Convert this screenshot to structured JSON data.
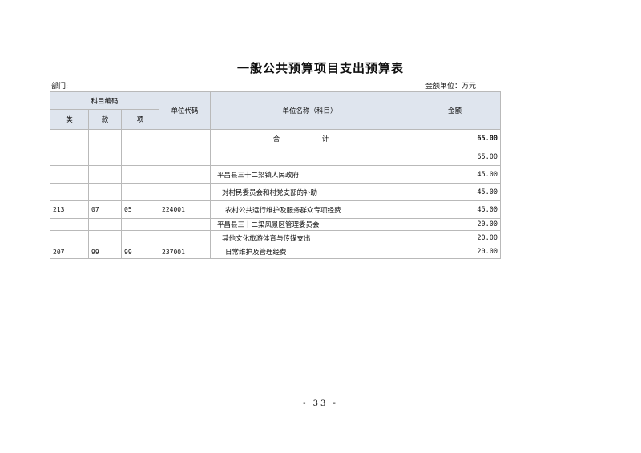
{
  "title": "一般公共预算项目支出预算表",
  "department_label": "部门:",
  "unit_label": "金额单位：万元",
  "headers": {
    "subject_code": "科目编码",
    "lei": "类",
    "kuan": "款",
    "xiang": "项",
    "unit_code": "单位代码",
    "unit_name": "单位名称（科目）",
    "amount": "金额"
  },
  "rows": [
    {
      "lei": "",
      "kuan": "",
      "xiang": "",
      "code": "",
      "name": "合　计",
      "amount": "65.00"
    },
    {
      "lei": "",
      "kuan": "",
      "xiang": "",
      "code": "",
      "name": "",
      "amount": "65.00"
    },
    {
      "lei": "",
      "kuan": "",
      "xiang": "",
      "code": "",
      "name": "平昌县三十二梁镇人民政府",
      "amount": "45.00"
    },
    {
      "lei": "",
      "kuan": "",
      "xiang": "",
      "code": "",
      "name": "对村民委员会和村党支部的补助",
      "amount": "45.00"
    },
    {
      "lei": "213",
      "kuan": "07",
      "xiang": "05",
      "code": "224001",
      "name": "农村公共运行维护及服务群众专项经费",
      "amount": "45.00"
    },
    {
      "lei": "",
      "kuan": "",
      "xiang": "",
      "code": "",
      "name": "平昌县三十二梁风景区管理委员会",
      "amount": "20.00"
    },
    {
      "lei": "",
      "kuan": "",
      "xiang": "",
      "code": "",
      "name": "其他文化旅游体育与传媒支出",
      "amount": "20.00"
    },
    {
      "lei": "207",
      "kuan": "99",
      "xiang": "99",
      "code": "237001",
      "name": "日常维护及管理经费",
      "amount": "20.00"
    }
  ],
  "page_number": "- 33 -"
}
